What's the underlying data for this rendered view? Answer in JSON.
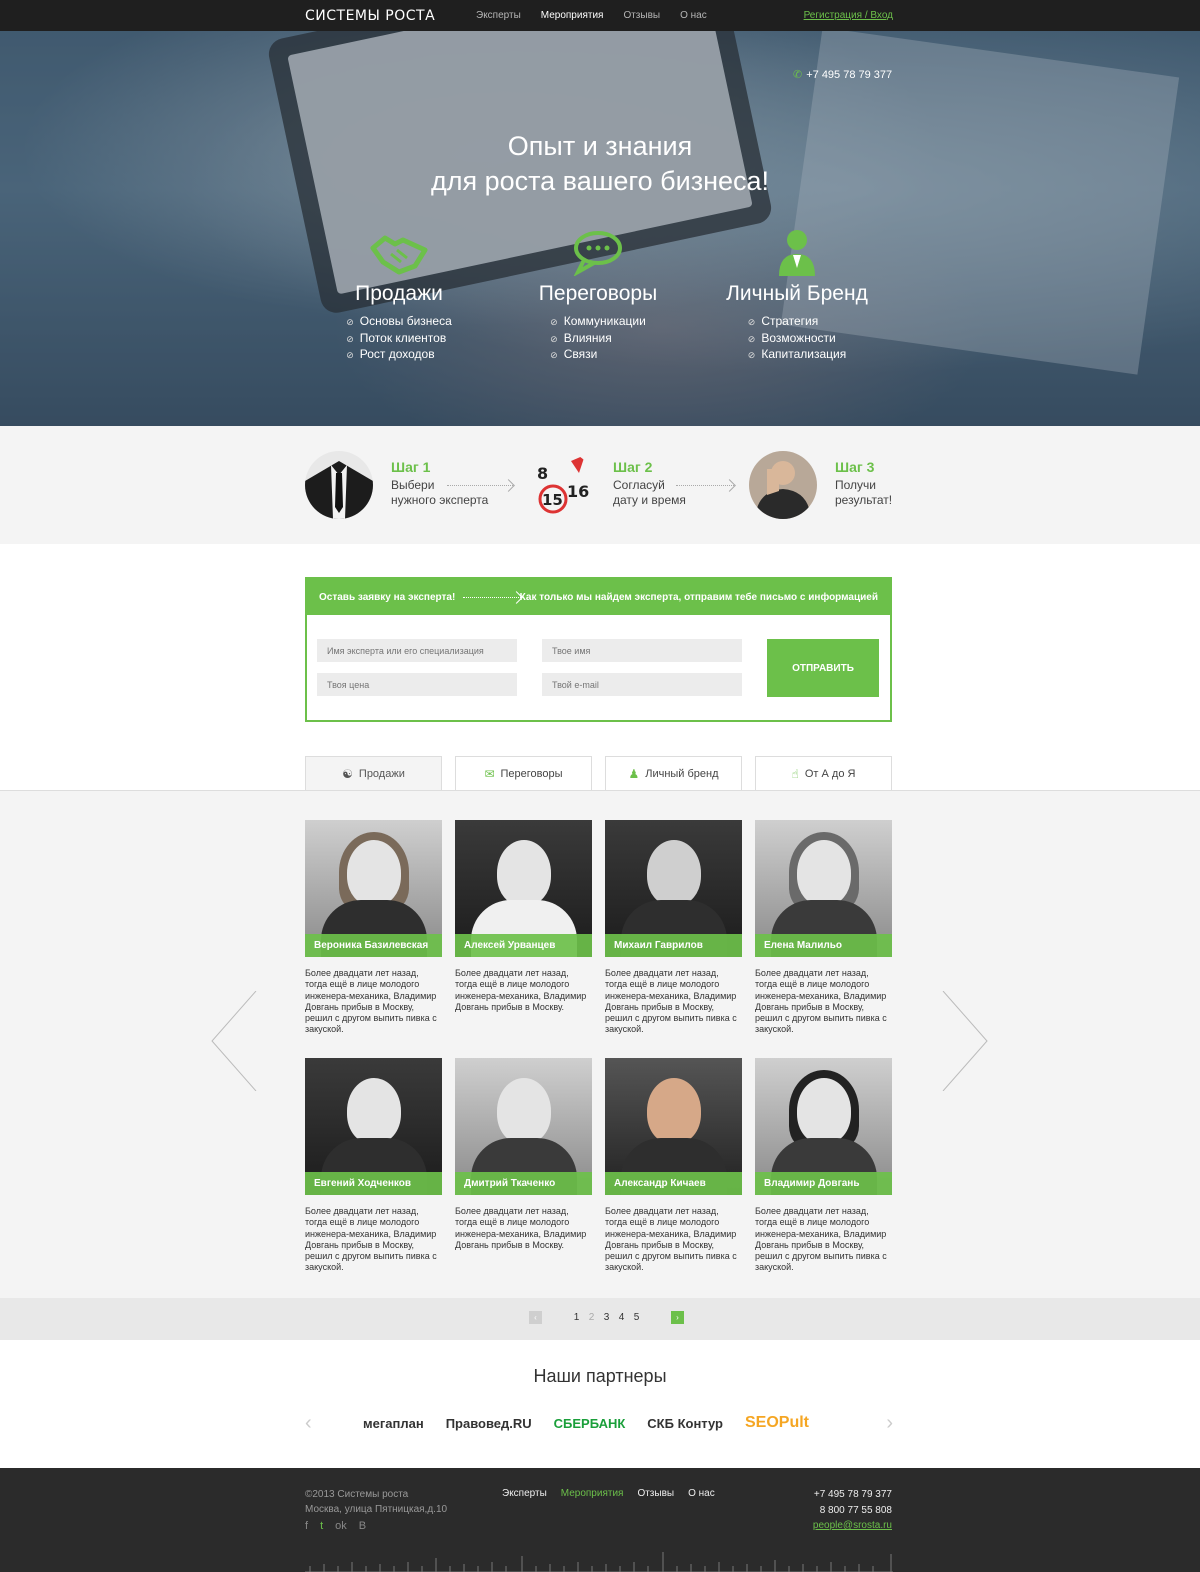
{
  "nav": {
    "logo": "СИСТЕМЫ РОСТА",
    "items": [
      "Эксперты",
      "Мероприятия",
      "Отзывы",
      "О нас"
    ],
    "auth": "Регистрация / Вход"
  },
  "hero": {
    "phone": "+7 495 78 79 377",
    "title_line1": "Опыт и знания",
    "title_line2": "для роста вашего бизнеса!",
    "pillars": [
      {
        "title": "Продажи",
        "icon": "handshake-icon",
        "items": [
          "Основы бизнеса",
          "Поток клиентов",
          "Рост доходов"
        ]
      },
      {
        "title": "Переговоры",
        "icon": "chat-bubbles-icon",
        "items": [
          "Коммуникации",
          "Влияния",
          "Связи"
        ]
      },
      {
        "title": "Личный Бренд",
        "icon": "person-icon",
        "items": [
          "Стратегия",
          "Возможности",
          "Капитализация"
        ]
      }
    ]
  },
  "steps": [
    {
      "title": "Шаг 1",
      "line1": "Выбери",
      "line2": "нужного эксперта"
    },
    {
      "title": "Шаг 2",
      "line1": "Согласуй",
      "line2": "дату и время"
    },
    {
      "title": "Шаг 3",
      "line1": "Получи",
      "line2": "результат!"
    }
  ],
  "form": {
    "left_text": "Оставь заявку на эксперта!",
    "right_text": "Как только мы найдем эксперта, отправим тебе письмо с информацией",
    "expert_placeholder": "Имя эксперта или его специализация",
    "price_placeholder": "Твоя цена",
    "name_placeholder": "Твое имя",
    "email_placeholder": "Твой e-mail",
    "submit": "ОТПРАВИТЬ"
  },
  "tabs": [
    {
      "label": "Продажи",
      "icon": "handshake-icon"
    },
    {
      "label": "Переговоры",
      "icon": "chat-bubbles-icon"
    },
    {
      "label": "Личный бренд",
      "icon": "person-icon"
    },
    {
      "label": "От А до Я",
      "icon": "thumbs-up-icon"
    }
  ],
  "experts": [
    {
      "name": "Вероника Базилевская",
      "desc": "Более двадцати лет назад, тогда ещё в лице молодого инженера-механика, Владимир Довгань прибыв в Москву, решил с другом выпить пивка с закуской."
    },
    {
      "name": "Алексей Урванцев",
      "desc": "Более двадцати лет назад, тогда ещё в лице молодого инженера-механика, Владимир Довгань прибыв в Москву."
    },
    {
      "name": "Михаил Гаврилов",
      "desc": "Более двадцати лет назад, тогда ещё в лице молодого инженера-механика, Владимир Довгань прибыв в Москву, решил с другом выпить пивка с закуской."
    },
    {
      "name": "Елена Малильо",
      "desc": "Более двадцати лет назад, тогда ещё в лице молодого инженера-механика, Владимир Довгань прибыв в Москву, решил с другом выпить пивка с закуской."
    },
    {
      "name": "Евгений Ходченков",
      "desc": "Более двадцати лет назад, тогда ещё в лице молодого инженера-механика, Владимир Довгань прибыв в Москву, решил с другом выпить пивка с закуской."
    },
    {
      "name": "Дмитрий Ткаченко",
      "desc": "Более двадцати лет назад, тогда ещё в лице молодого инженера-механика, Владимир Довгань прибыв в Москву."
    },
    {
      "name": "Александр Кичаев",
      "desc": "Более двадцати лет назад, тогда ещё в лице молодого инженера-механика, Владимир Довгань прибыв в Москву, решил с другом выпить пивка с закуской."
    },
    {
      "name": "Владимир Довгань",
      "desc": "Более двадцати лет назад, тогда ещё в лице молодого инженера-механика, Владимир Довгань прибыв в Москву, решил с другом выпить пивка с закуской."
    }
  ],
  "pager": {
    "prev": "‹",
    "pages": [
      "1",
      "2",
      "3",
      "4",
      "5"
    ],
    "current": "2",
    "next": "›"
  },
  "partners": {
    "title": "Наши партнеры",
    "logos": [
      {
        "name": "мегаплан",
        "color": "#333333"
      },
      {
        "name": "Правовед.RU",
        "color": "#333333"
      },
      {
        "name": "СБЕРБАНК",
        "color": "#1a9f3a"
      },
      {
        "name": "СКБ Контур",
        "color": "#333333"
      },
      {
        "name": "SEOPult",
        "color": "#f5a623"
      }
    ]
  },
  "footer": {
    "copyright": "©2013 Системы роста",
    "address": "Москва, улица Пятницкая,д.10",
    "menu": [
      "Эксперты",
      "Мероприятия",
      "Отзывы",
      "О нас"
    ],
    "phone1": "+7 495 78 79 377",
    "phone2": "8 800 77 55 808",
    "email": "people@srosta.ru",
    "social": [
      "f",
      "t",
      "ok",
      "B"
    ]
  },
  "colors": {
    "accent": "#6cc04a",
    "nav_bg": "#1f1f1f",
    "footer_bg": "#2b2b2b"
  }
}
